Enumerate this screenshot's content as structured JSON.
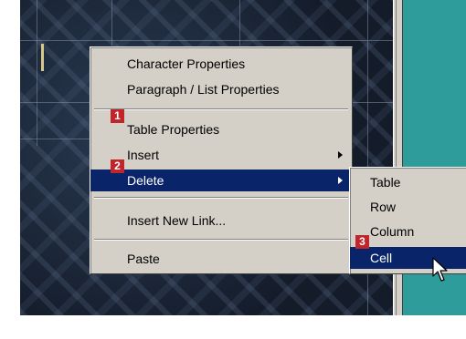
{
  "context_menu": {
    "items": [
      {
        "label": "Character Properties"
      },
      {
        "label": "Paragraph / List Properties"
      },
      {
        "label": "Table Properties"
      },
      {
        "label": "Insert"
      },
      {
        "label": "Delete"
      },
      {
        "label": "Insert New Link..."
      },
      {
        "label": "Paste"
      }
    ]
  },
  "submenu": {
    "items": [
      {
        "label": "Table"
      },
      {
        "label": "Row"
      },
      {
        "label": "Column"
      },
      {
        "label": "Cell"
      }
    ]
  },
  "badges": [
    "1",
    "2",
    "3"
  ],
  "colors": {
    "menu_bg": "#d4d0c8",
    "highlight": "#0a246a",
    "badge": "#c0252b",
    "teal_panel": "#2f9c9c",
    "editor_bg": "#1b2638"
  },
  "icons": [
    "submenu-arrow-icon",
    "mouse-pointer-icon"
  ]
}
